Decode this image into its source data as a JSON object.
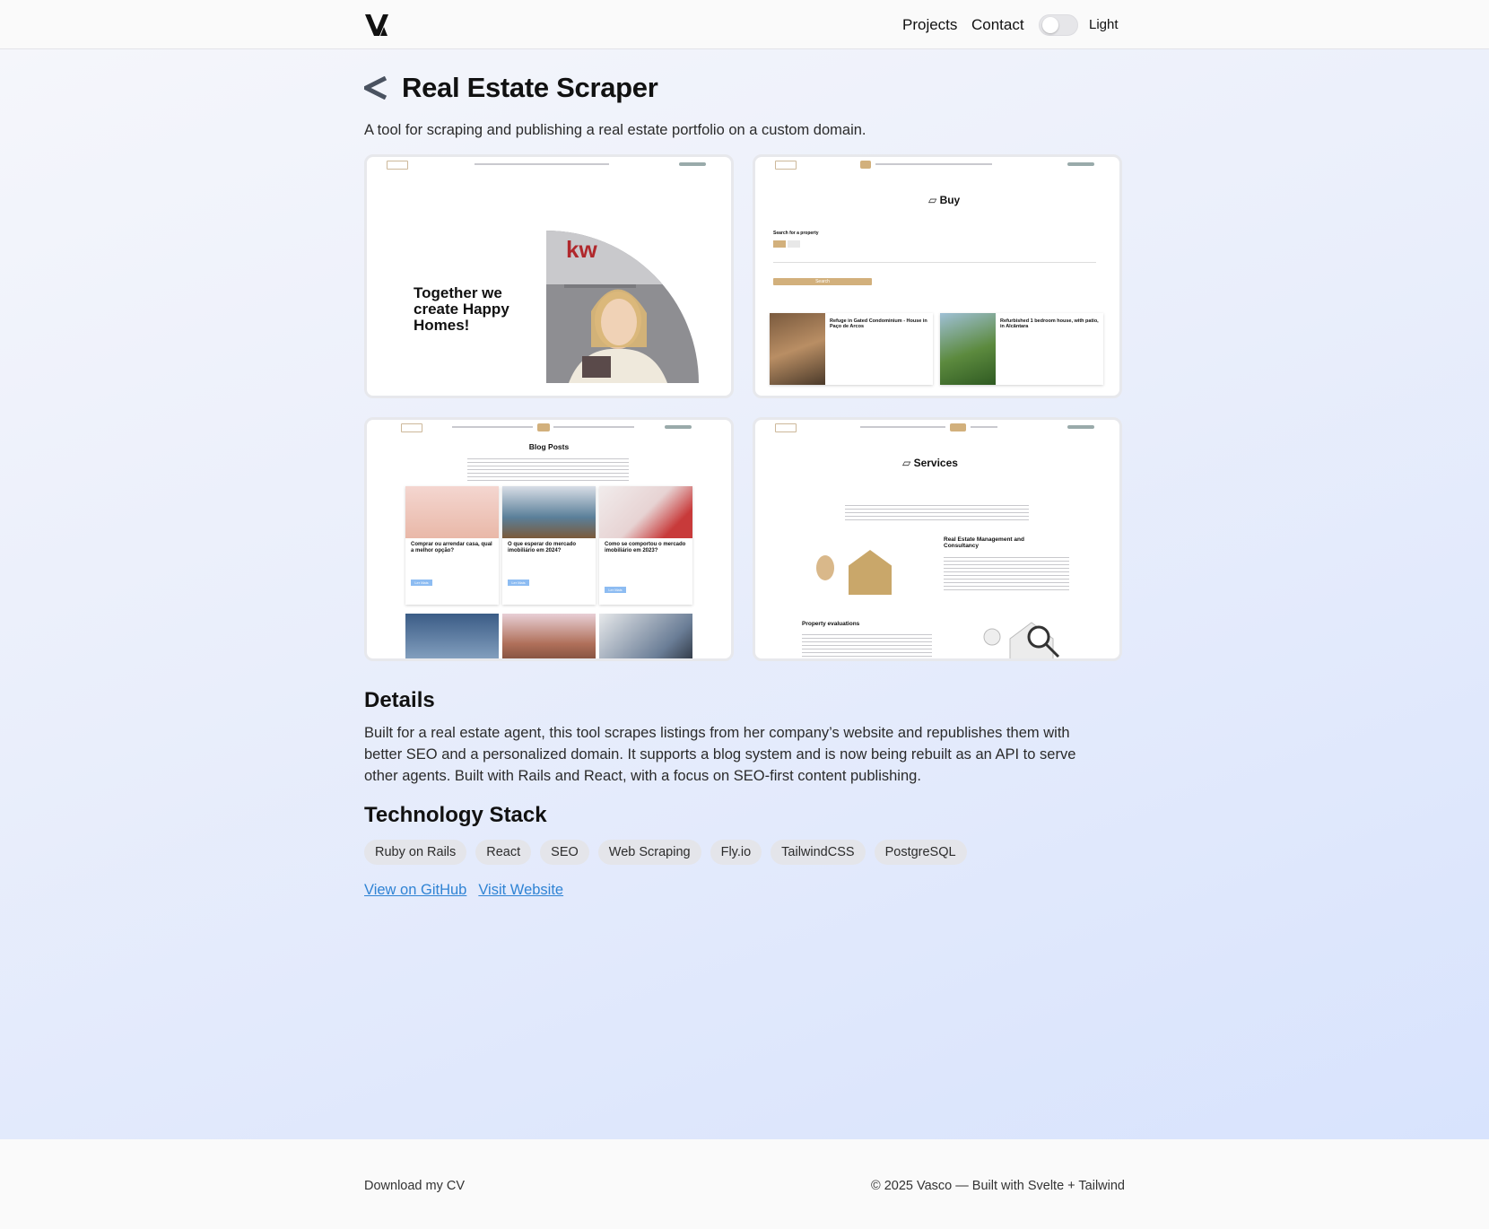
{
  "header": {
    "nav": [
      "Projects",
      "Contact"
    ],
    "theme_label": "Light"
  },
  "project": {
    "title": "Real Estate Scraper",
    "subtitle": "A tool for scraping and publishing a real estate portfolio on a custom domain."
  },
  "screenshots": {
    "home": {
      "headline": "Together we create Happy Homes!"
    },
    "buy": {
      "heading": "Buy",
      "search_label": "Search for a property",
      "search_button": "Search",
      "listings": [
        "Refuge in Gated Condominium - House in Paço de Arcos",
        "Refurbished 1 bedroom house, with patio, in Alcântara"
      ]
    },
    "blog": {
      "heading": "Blog Posts",
      "posts": [
        "Comprar ou arrendar casa, qual a melhor opção?",
        "O que esperar do mercado imobiliário em 2024?",
        "Como se comportou o mercado imobiliário em 2023?"
      ],
      "read_more": "Ler Mais"
    },
    "services": {
      "heading": "Services",
      "service_1": "Real Estate Management and Consultancy",
      "service_2": "Property evaluations"
    }
  },
  "details": {
    "heading": "Details",
    "text": "Built for a real estate agent, this tool scrapes listings from her company’s website and republishes them with better SEO and a personalized domain. It supports a blog system and is now being rebuilt as an API to serve other agents. Built with Rails and React, with a focus on SEO-first content publishing."
  },
  "tech_stack": {
    "heading": "Technology Stack",
    "tags": [
      "Ruby on Rails",
      "React",
      "SEO",
      "Web Scraping",
      "Fly.io",
      "TailwindCSS",
      "PostgreSQL"
    ]
  },
  "links": {
    "github": "View on GitHub",
    "website": "Visit Website"
  },
  "footer": {
    "cv": "Download my CV",
    "copyright": "© 2025 Vasco — Built with Svelte + Tailwind"
  },
  "colors": {
    "link": "#2f83d4",
    "accent_gold": "#d2b07c",
    "tag_bg": "#e4e5ea"
  }
}
